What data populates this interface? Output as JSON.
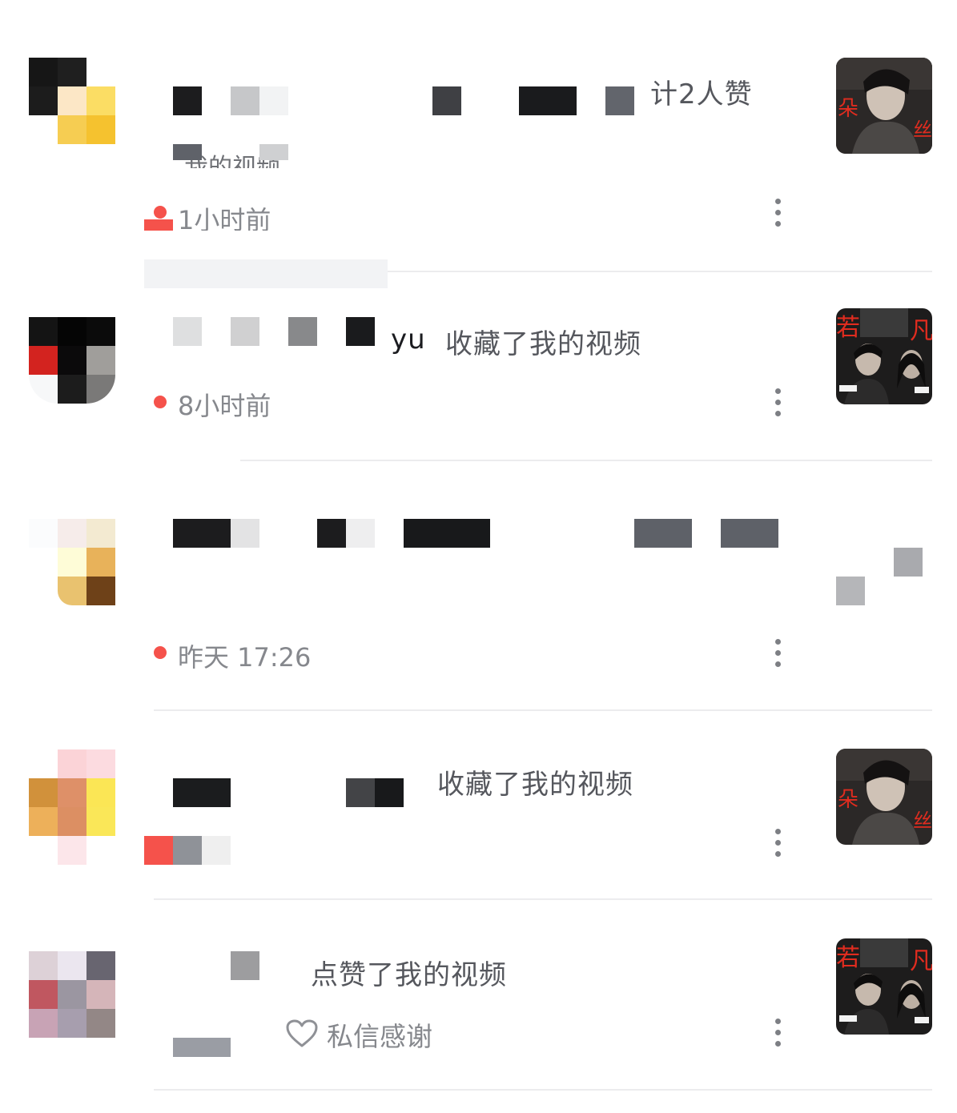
{
  "notifications": [
    {
      "action": "计2人赞",
      "subtext": "我的视频",
      "time": "1小时前",
      "thumbnail_icon": "video-cover-icon"
    },
    {
      "name_suffix": "yu",
      "action": "收藏了我的视频",
      "time": "8小时前",
      "thumbnail_icon": "video-cover-icon"
    },
    {
      "time": "昨天 17:26"
    },
    {
      "action": "收藏了我的视频",
      "thumbnail_icon": "video-cover-icon"
    },
    {
      "action": "点赞了我的视频",
      "thank_label": "私信感谢",
      "thumbnail_icon": "video-cover-icon"
    }
  ],
  "colors": {
    "unread_dot": "#f5524b",
    "action_text": "#55575d",
    "time_text": "#86888d",
    "divider": "#ececee"
  },
  "icons": {
    "more": "more-vertical-icon",
    "heart": "heart-outline-icon"
  }
}
